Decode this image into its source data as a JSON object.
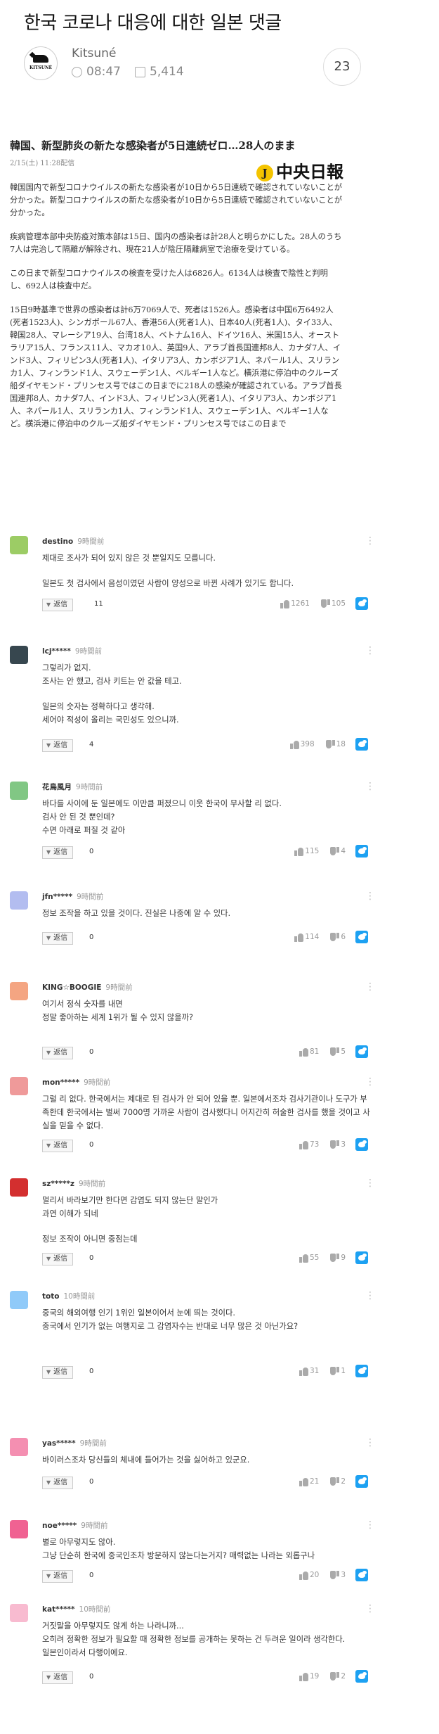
{
  "post": {
    "title": "한국 코로나 대응에 대한 일본 댓글",
    "author": "Kitsuné",
    "logo_text": "KITSUNÉ",
    "time": "08:47",
    "views": "5,414",
    "comment_count": "23"
  },
  "article": {
    "headline": "韓国、新型肺炎の新たな感染者が5日連続ゼロ…28人のまま",
    "date": "2/15(土) 11:28配信",
    "source_logo": "中央日報",
    "source_logo_letter": "J",
    "paragraphs": [
      "韓国国内で新型コロナウイルスの新たな感染者が10日から5日連続で確認されていないことが分かった。新型コロナウイルスの新たな感染者が10日から5日連続で確認されていないことが分かった。",
      "疾病管理本部中央防疫対策本部は15日、国内の感染者は計28人と明らかにした。28人のうち7人は完治して隔離が解除され、現在21人が陰圧隔離病室で治療を受けている。",
      "この日まで新型コロナウイルスの検査を受けた人は6826人。6134人は検査で陰性と判明し、692人は検査中だ。",
      "15日9時基準で世界の感染者は計6万7069人で、死者は1526人。感染者は中国6万6492人(死者1523人)、シンガポール67人、香港56人(死者1人)、日本40人(死者1人)、タイ33人、韓国28人、マレーシア19人、台湾18人、ベトナム16人、ドイツ16人、米国15人、オーストラリア15人、フランス11人、マカオ10人、英国9人、アラブ首長国連邦8人、カナダ7人、インド3人、フィリピン3人(死者1人)、イタリア3人、カンボジア1人、ネパール1人、スリランカ1人、フィンランド1人、スウェーデン1人、ベルギー1人など。横浜港に停泊中のクルーズ船ダイヤモンド・プリンセス号ではこの日までに218人の感染が確認されている。アラブ首長国連邦8人、カナダ7人、インド3人、フィリピン3人(死者1人)、イタリア3人、カンボジア1人、ネパール1人、スリランカ1人、フィンランド1人、スウェーデン1人、ベルギー1人など。横浜港に停泊中のクルーズ船ダイヤモンド・プリンセス号ではこの日まで"
    ]
  },
  "reply_label": "返信",
  "comments": [
    {
      "user": "destino",
      "time": "9時間前",
      "avatar_color": "#9ccc65",
      "lines": [
        "제대로 조사가 되어 있지 않은 것 뿐일지도 모릅니다.",
        "",
        "일본도 첫 검사에서 음성이였던 사람이 양성으로 바뀐 사례가 있기도 합니다."
      ],
      "replies": "11",
      "up": "1261",
      "down": "105"
    },
    {
      "user": "lcj*****",
      "time": "9時間前",
      "avatar_color": "#37474f",
      "lines": [
        "그렇리가 없지.",
        "조사는 안 했고, 검사 키트는 안 값을 테고.",
        "",
        "일본의 숫자는 정확하다고 생각해.",
        "세어야 적성이 올리는 국민성도 있으니까."
      ],
      "replies": "4",
      "up": "398",
      "down": "18"
    },
    {
      "user": "花鳥風月",
      "time": "9時間前",
      "avatar_color": "#81c784",
      "lines": [
        "바다를 사이에 둔 일본에도 이만큼 퍼졌으니 이웃 한국이 무사할 리 없다.",
        "검사 안 된 것 뿐인데?",
        "수면 아래로 퍼질 것 같아"
      ],
      "replies": "0",
      "up": "115",
      "down": "4"
    },
    {
      "user": "jfn*****",
      "time": "9時間前",
      "avatar_color": "#b3bdf0",
      "lines": [
        "정보 조작을 하고 있을 것이다. 진실은 나중에 알 수 있다."
      ],
      "replies": "0",
      "up": "114",
      "down": "6"
    },
    {
      "user": "KING☆BOOGIE",
      "time": "9時間前",
      "avatar_color": "#f4a582",
      "lines": [
        "여기서 정식 숫자를 내면",
        "정말 좋아하는 세계 1위가 될 수 있지 않을까?"
      ],
      "replies": "0",
      "up": "81",
      "down": "5"
    },
    {
      "user": "mon*****",
      "time": "9時間前",
      "avatar_color": "#ef9a9a",
      "lines": [
        "그럴 리 없다. 한국에서는 제대로 된 검사가 안 되어 있을 뿐. 일본에서조차 검사기관이나 도구가 부족한데 한국에서는 벌써 7000명 가까운 사람이 검사했다니 어지간히 허술한 검사를 했을 것이고 사실을 믿을 수 없다."
      ],
      "replies": "0",
      "up": "73",
      "down": "3"
    },
    {
      "user": "sz*****z",
      "time": "9時間前",
      "avatar_color": "#d32f2f",
      "lines": [
        "멀리서 바라보기만 한다면 감염도 되지 않는단 말인가",
        "과연 이해가 되네",
        "",
        "정보 조작이 아니면 중점는데"
      ],
      "replies": "0",
      "up": "55",
      "down": "9"
    },
    {
      "user": "toto",
      "time": "10時間前",
      "avatar_color": "#90caf9",
      "lines": [
        "중국의 해외여행 인기 1위인 일본이어서 눈에 띄는 것이다.",
        "중국에서 인기가 없는 여행지로 그 감염자수는 반대로 너무 많은 것 아닌가요?"
      ],
      "replies": "0",
      "up": "31",
      "down": "1"
    },
    {
      "user": "yas*****",
      "time": "9時間前",
      "avatar_color": "#f48fb1",
      "lines": [
        "바이러스조차 당신들의 체내에 들어가는 것을 싫어하고 있군요."
      ],
      "replies": "0",
      "up": "21",
      "down": "2"
    },
    {
      "user": "noe*****",
      "time": "9時間前",
      "avatar_color": "#f06292",
      "lines": [
        "별로 아무렇지도 않아.",
        "그냥 단순히 한국에 중국인조차 방문하지 않는다는거지? 매력없는 나라는 외롭구나"
      ],
      "replies": "0",
      "up": "20",
      "down": "3"
    },
    {
      "user": "kat*****",
      "time": "10時間前",
      "avatar_color": "#f8bbd0",
      "lines": [
        "거짓말을 아무렇지도 않게 하는 나라니까...",
        "오히려 정확한 정보가 필요할 때 정확한 정보를 공개하는 못하는 건 두려운 일이라 생각한다.",
        "일본인이라서 다행이에요."
      ],
      "replies": "0",
      "up": "19",
      "down": "2"
    }
  ]
}
